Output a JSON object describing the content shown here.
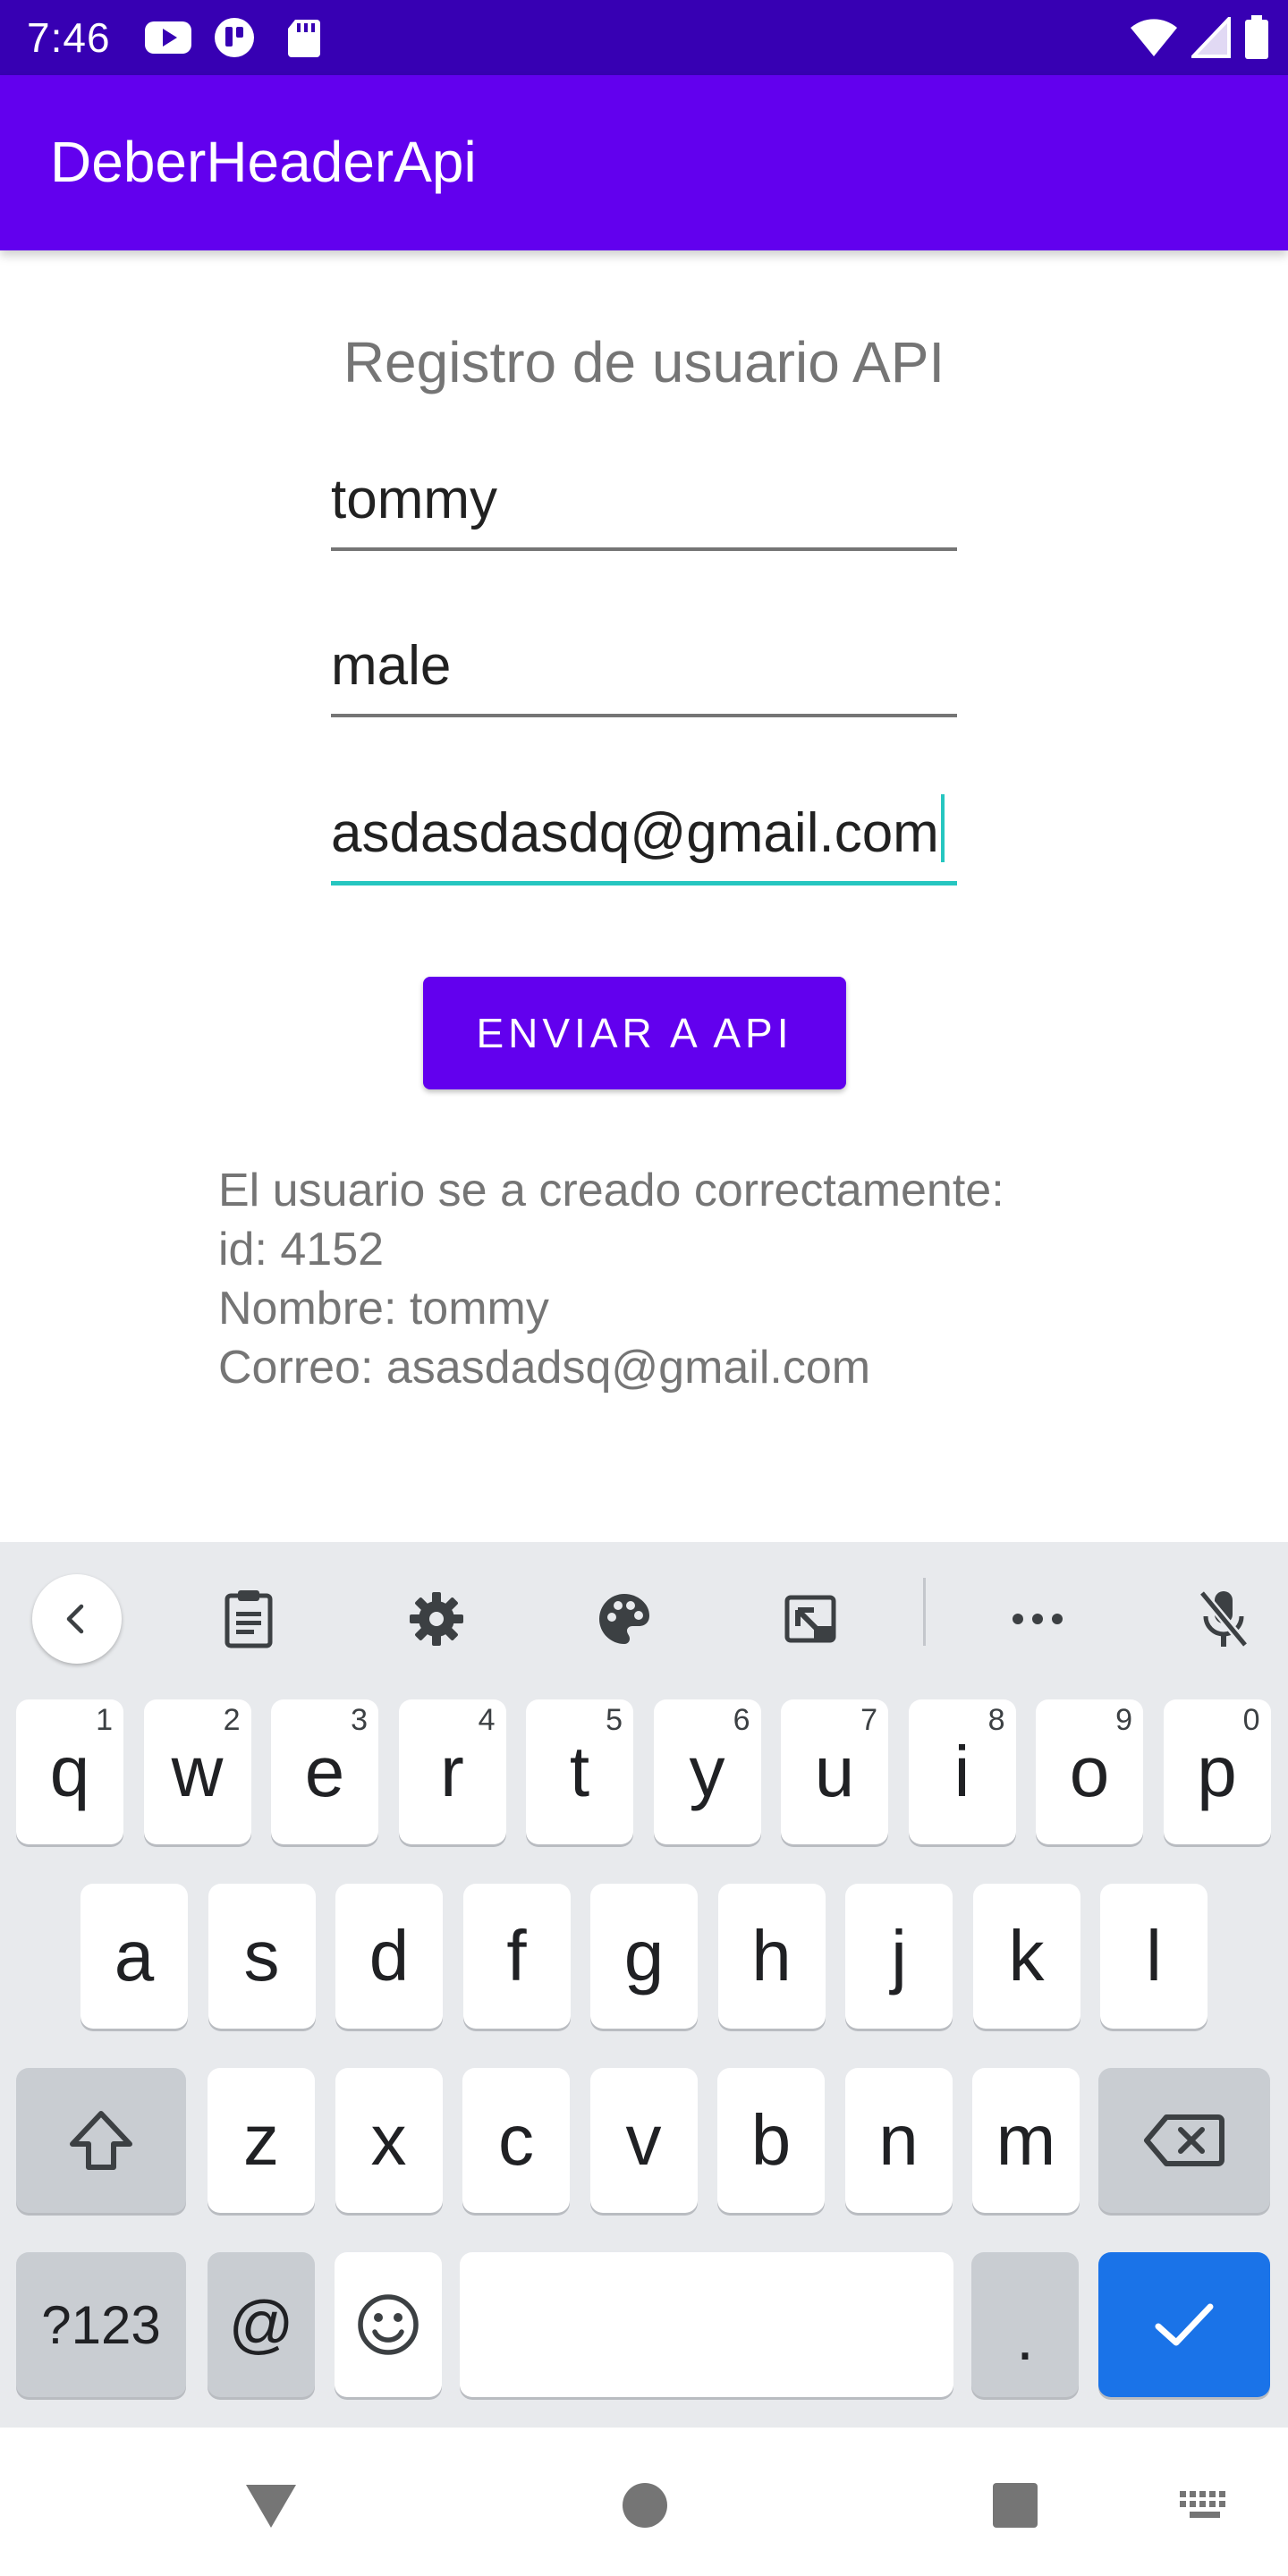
{
  "status_bar": {
    "time": "7:46"
  },
  "app_bar": {
    "title": "DeberHeaderApi"
  },
  "form": {
    "title": "Registro de usuario API",
    "fields": [
      {
        "value": "tommy"
      },
      {
        "value": "male"
      },
      {
        "value": "asdasdasdq@gmail.com",
        "focused": true
      }
    ],
    "submit_label": "ENVIAR A API"
  },
  "result": {
    "line1": "El usuario se a creado correctamente:",
    "line2": "id: 4152",
    "line3": "Nombre: tommy",
    "line4": "Correo: asasdadsq@gmail.com"
  },
  "keyboard": {
    "toolbar_icons": [
      "chevron-left-icon",
      "clipboard-icon",
      "gear-icon",
      "palette-icon",
      "resize-icon",
      "more-icon",
      "mic-off-icon"
    ],
    "row1": [
      {
        "k": "q",
        "h": "1"
      },
      {
        "k": "w",
        "h": "2"
      },
      {
        "k": "e",
        "h": "3"
      },
      {
        "k": "r",
        "h": "4"
      },
      {
        "k": "t",
        "h": "5"
      },
      {
        "k": "y",
        "h": "6"
      },
      {
        "k": "u",
        "h": "7"
      },
      {
        "k": "i",
        "h": "8"
      },
      {
        "k": "o",
        "h": "9"
      },
      {
        "k": "p",
        "h": "0"
      }
    ],
    "row2": [
      "a",
      "s",
      "d",
      "f",
      "g",
      "h",
      "j",
      "k",
      "l"
    ],
    "row3": [
      "z",
      "x",
      "c",
      "v",
      "b",
      "n",
      "m"
    ],
    "symbols_label": "?123",
    "at_label": "@",
    "period_label": "."
  },
  "colors": {
    "status_bar": "#3700b3",
    "app_bar": "#6200ee",
    "accent_focus": "#26c6c0",
    "enter_key": "#1a73e8"
  }
}
